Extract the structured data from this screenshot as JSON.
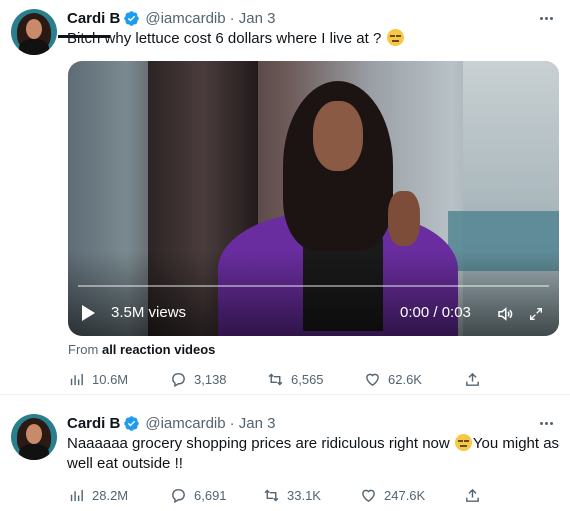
{
  "tweets": [
    {
      "name": "Cardi B",
      "handle": "@iamcardib",
      "date": "· Jan 3",
      "text_struck": "Bitch",
      "text": "why lettuce cost 6 dollars where I live at ?",
      "media": {
        "views": "3.5M views",
        "time": "0:00 / 0:03"
      },
      "from_prefix": "From",
      "from_link": "all reaction videos",
      "stats": {
        "views": "10.6M",
        "replies": "3,138",
        "retweets": "6,565",
        "likes": "62.6K"
      }
    },
    {
      "name": "Cardi B",
      "handle": "@iamcardib",
      "date": "· Jan 3",
      "text_a": "Naaaaaa grocery shopping prices are ridiculous right now",
      "text_b": "You might as well eat outside !!",
      "stats": {
        "views": "28.2M",
        "replies": "6,691",
        "retweets": "33.1K",
        "likes": "247.6K"
      }
    }
  ],
  "colors": {
    "verified": "#1d9bf0",
    "muted": "#536471",
    "text": "#0f1419"
  },
  "icons": [
    "verified-badge-icon",
    "more-icon",
    "play-icon",
    "volume-icon",
    "fullscreen-icon",
    "analytics-icon",
    "reply-icon",
    "retweet-icon",
    "like-icon",
    "share-icon"
  ]
}
